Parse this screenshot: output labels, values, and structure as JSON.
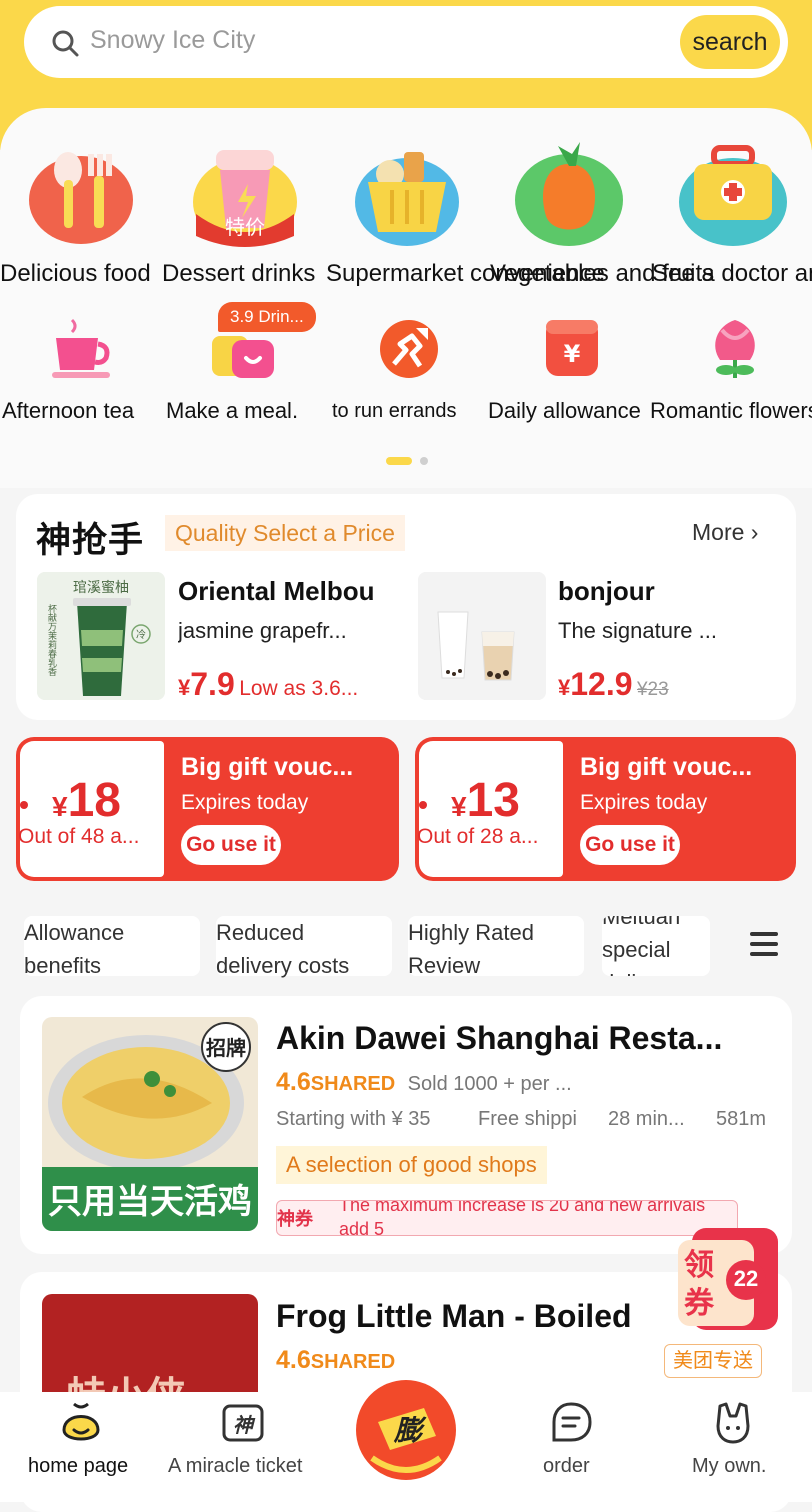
{
  "search": {
    "placeholder": "Snowy Ice City",
    "button": "search"
  },
  "categories_row1": [
    {
      "label": "Delicious food",
      "icon": "spoon-fork-icon"
    },
    {
      "label": "Dessert drinks",
      "icon": "drink-cup-icon",
      "tag": "特价"
    },
    {
      "label": "Supermarket convenience",
      "icon": "shopping-basket-icon"
    },
    {
      "label": "Vegetables and fruits",
      "icon": "fruit-icon"
    },
    {
      "label": "See a doctor and",
      "icon": "medicine-box-icon"
    }
  ],
  "categories_row2": [
    {
      "label": "Afternoon tea",
      "icon": "teacup-icon"
    },
    {
      "label": "Make a meal.",
      "icon": "meal-box-icon"
    },
    {
      "label": "to run errands",
      "icon": "errand-runner-icon"
    },
    {
      "label": "Daily allowance",
      "icon": "allowance-icon"
    },
    {
      "label": "Romantic flowers",
      "icon": "flower-icon"
    }
  ],
  "drink_badge": "3.9 Drin...",
  "flash_sale": {
    "title": "神抢手",
    "tag": "Quality Select a Price",
    "more": "More",
    "products": [
      {
        "name": "Oriental Melbou",
        "desc": "jasmine grapefr...",
        "currency": "¥",
        "price": "7.9",
        "note": "Low as 3.6...",
        "image_text": "琯溪蜜柚",
        "image_side_text": "杯献万茉莉春乳香",
        "image_badge": "冷"
      },
      {
        "name": "bonjour",
        "desc": "The signature ...",
        "currency": "¥",
        "price": "12.9",
        "original": "¥23"
      }
    ]
  },
  "vouchers": [
    {
      "currency": "¥",
      "amount": "18",
      "condition": "Out of 48 a...",
      "title": "Big gift vouc...",
      "expires": "Expires today",
      "button": "Go use it"
    },
    {
      "currency": "¥",
      "amount": "13",
      "condition": "Out of 28 a...",
      "title": "Big gift vouc...",
      "expires": "Expires today",
      "button": "Go use it"
    }
  ],
  "filters": [
    {
      "line1": "Allowance",
      "line2": "benefits"
    },
    {
      "line1": "Reduced",
      "line2": "delivery costs"
    },
    {
      "line1": "Highly Rated",
      "line2": "Review"
    },
    {
      "line1": "Meituan",
      "line2": "special",
      "line3": "delivery"
    }
  ],
  "shops": [
    {
      "name": "Akin Dawei Shanghai Resta...",
      "rating": "4.6",
      "rating_tag": "SHARED",
      "sold": "Sold 1000 + per ...",
      "start": "Starting with ¥ 35",
      "shipping": "Free shippi",
      "time": "28 min...",
      "distance": "581m",
      "highlight": "A selection of good shops",
      "promo_tag": "神券",
      "promo": "The maximum increase is 20 and new arrivals add 5",
      "image_badge": "招牌",
      "image_caption": "只用当天活鸡"
    },
    {
      "name": "Frog Little Man - Boiled",
      "rating": "4.6",
      "rating_tag": "SHARED",
      "delivery_tag": "美团专送",
      "image_text": "蛙小侠"
    }
  ],
  "float_coupon": {
    "text1": "领",
    "text2": "券",
    "count": "22"
  },
  "bottom_nav": [
    {
      "label": "home page",
      "icon": "home-face-icon"
    },
    {
      "label": "A miracle ticket",
      "icon": "ticket-icon"
    },
    {
      "label": "膨",
      "icon": "inflate-center-icon"
    },
    {
      "label": "order",
      "icon": "order-icon"
    },
    {
      "label": "My own.",
      "icon": "profile-icon"
    }
  ],
  "colors": {
    "brand_yellow": "#fbd84a",
    "price_red": "#e22d2d",
    "rating_orange": "#f08a1a"
  }
}
